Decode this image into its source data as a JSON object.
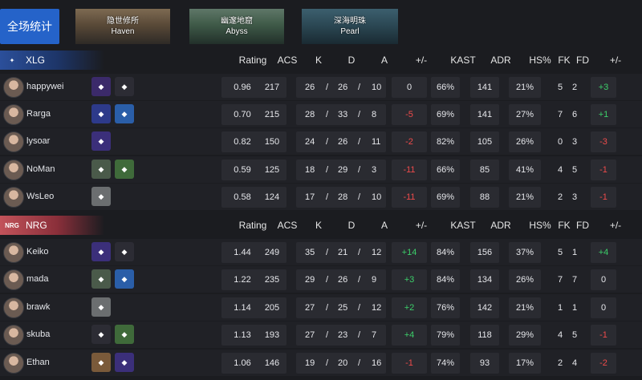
{
  "nav": {
    "all_stats": "全场统计",
    "maps": [
      {
        "cn": "隐世修所",
        "en": "Haven"
      },
      {
        "cn": "幽邃地窟",
        "en": "Abyss"
      },
      {
        "cn": "深海明珠",
        "en": "Pearl"
      }
    ]
  },
  "columns": [
    "Rating",
    "ACS",
    "K",
    "D",
    "A",
    "+/-",
    "KAST",
    "ADR",
    "HS%",
    "FK",
    "FD",
    "+/-"
  ],
  "teams": [
    {
      "name": "XLG",
      "players": [
        {
          "name": "happywei",
          "agents": [
            "agent-a",
            "agent-b"
          ],
          "rating": "0.96",
          "acs": "217",
          "k": "26",
          "d": "26",
          "a": "10",
          "diff": "0",
          "kast": "66%",
          "adr": "141",
          "hs": "21%",
          "fk": "5",
          "fd": "2",
          "fdiff": "+3"
        },
        {
          "name": "Rarga",
          "agents": [
            "agent-c",
            "agent-d"
          ],
          "rating": "0.70",
          "acs": "215",
          "k": "28",
          "d": "33",
          "a": "8",
          "diff": "-5",
          "kast": "69%",
          "adr": "141",
          "hs": "27%",
          "fk": "7",
          "fd": "6",
          "fdiff": "+1"
        },
        {
          "name": "lysoar",
          "agents": [
            "agent-e"
          ],
          "rating": "0.82",
          "acs": "150",
          "k": "24",
          "d": "26",
          "a": "11",
          "diff": "-2",
          "kast": "82%",
          "adr": "105",
          "hs": "26%",
          "fk": "0",
          "fd": "3",
          "fdiff": "-3"
        },
        {
          "name": "NoMan",
          "agents": [
            "agent-f",
            "agent-g"
          ],
          "rating": "0.59",
          "acs": "125",
          "k": "18",
          "d": "29",
          "a": "3",
          "diff": "-11",
          "kast": "66%",
          "adr": "85",
          "hs": "41%",
          "fk": "4",
          "fd": "5",
          "fdiff": "-1"
        },
        {
          "name": "WsLeo",
          "agents": [
            "agent-h"
          ],
          "rating": "0.58",
          "acs": "124",
          "k": "17",
          "d": "28",
          "a": "10",
          "diff": "-11",
          "kast": "69%",
          "adr": "88",
          "hs": "21%",
          "fk": "2",
          "fd": "3",
          "fdiff": "-1"
        }
      ]
    },
    {
      "name": "NRG",
      "players": [
        {
          "name": "Keiko",
          "agents": [
            "agent-e",
            "agent-b"
          ],
          "rating": "1.44",
          "acs": "249",
          "k": "35",
          "d": "21",
          "a": "12",
          "diff": "+14",
          "kast": "84%",
          "adr": "156",
          "hs": "37%",
          "fk": "5",
          "fd": "1",
          "fdiff": "+4"
        },
        {
          "name": "mada",
          "agents": [
            "agent-f",
            "agent-d"
          ],
          "rating": "1.22",
          "acs": "235",
          "k": "29",
          "d": "26",
          "a": "9",
          "diff": "+3",
          "kast": "84%",
          "adr": "134",
          "hs": "26%",
          "fk": "7",
          "fd": "7",
          "fdiff": "0"
        },
        {
          "name": "brawk",
          "agents": [
            "agent-h"
          ],
          "rating": "1.14",
          "acs": "205",
          "k": "27",
          "d": "25",
          "a": "12",
          "diff": "+2",
          "kast": "76%",
          "adr": "142",
          "hs": "21%",
          "fk": "1",
          "fd": "1",
          "fdiff": "0"
        },
        {
          "name": "skuba",
          "agents": [
            "agent-b",
            "agent-g"
          ],
          "rating": "1.13",
          "acs": "193",
          "k": "27",
          "d": "23",
          "a": "7",
          "diff": "+4",
          "kast": "79%",
          "adr": "118",
          "hs": "29%",
          "fk": "4",
          "fd": "5",
          "fdiff": "-1"
        },
        {
          "name": "Ethan",
          "agents": [
            "agent-i",
            "agent-e"
          ],
          "rating": "1.06",
          "acs": "146",
          "k": "19",
          "d": "20",
          "a": "16",
          "diff": "-1",
          "kast": "74%",
          "adr": "93",
          "hs": "17%",
          "fk": "2",
          "fd": "4",
          "fdiff": "-2"
        }
      ]
    }
  ],
  "colors": {
    "accent": "#2563c9",
    "positive": "#3ccf6a",
    "negative": "#ee4b4b",
    "xlg": "#2b4f9a",
    "nrg": "#c2535a"
  }
}
